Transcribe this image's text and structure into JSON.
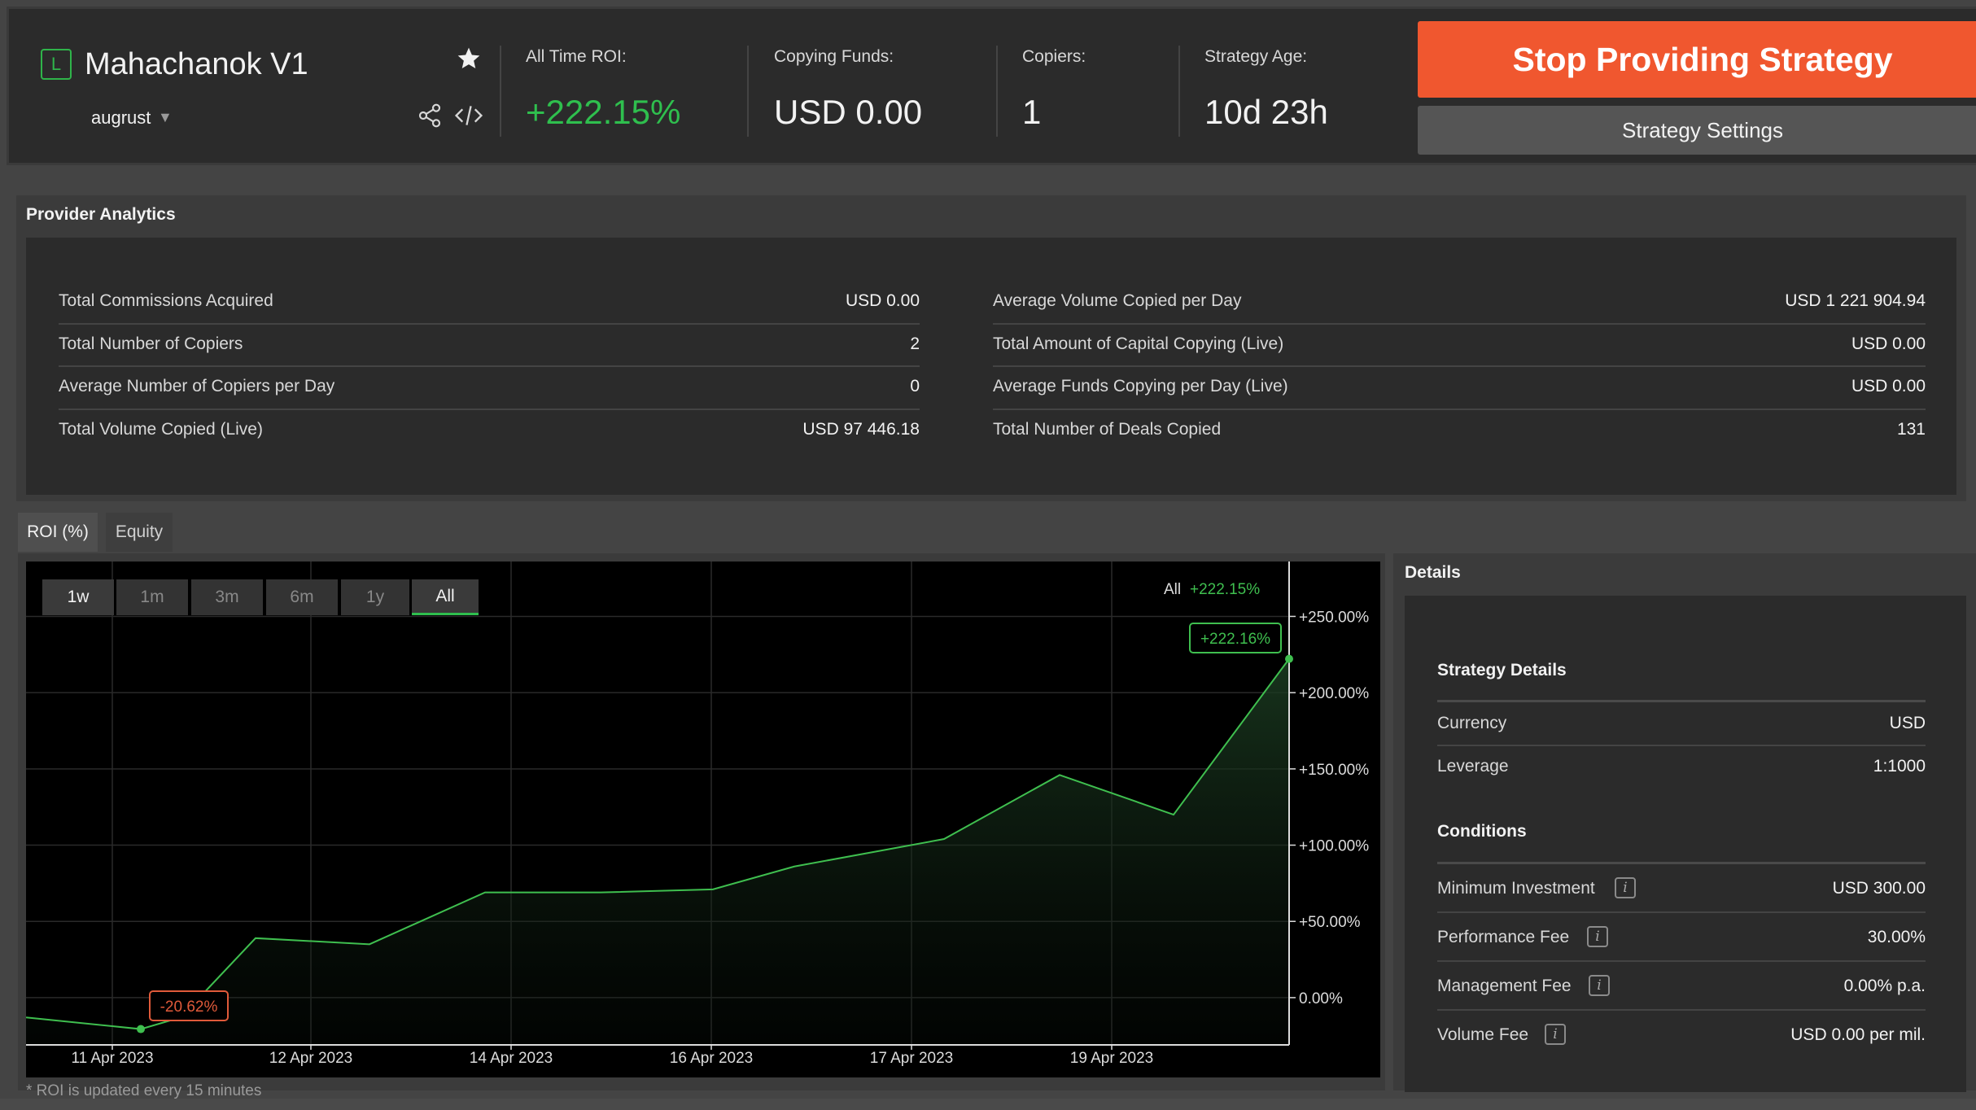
{
  "header": {
    "badge": "L",
    "strategy_name": "Mahachanok V1",
    "author": "augrust",
    "stats": [
      {
        "label": "All Time ROI:",
        "value": "+222.15%"
      },
      {
        "label": "Copying Funds:",
        "value": "USD 0.00"
      },
      {
        "label": "Copiers:",
        "value": "1"
      },
      {
        "label": "Strategy Age:",
        "value": "10d 23h"
      }
    ],
    "stop_button": "Stop Providing Strategy",
    "settings_button": "Strategy Settings"
  },
  "analytics": {
    "title": "Provider Analytics",
    "left": [
      {
        "label": "Total Commissions Acquired",
        "value": "USD 0.00"
      },
      {
        "label": "Total Number of Copiers",
        "value": "2"
      },
      {
        "label": "Average Number of Copiers per Day",
        "value": "0"
      },
      {
        "label": "Total Volume Copied (Live)",
        "value": "USD 97 446.18"
      }
    ],
    "right": [
      {
        "label": "Average Volume Copied per Day",
        "value": "USD 1 221 904.94"
      },
      {
        "label": "Total Amount of Capital Copying (Live)",
        "value": "USD 0.00"
      },
      {
        "label": "Average Funds Copying per Day (Live)",
        "value": "USD 0.00"
      },
      {
        "label": "Total Number of Deals Copied",
        "value": "131"
      }
    ]
  },
  "tabs": {
    "roi": "ROI (%)",
    "equity": "Equity"
  },
  "chart": {
    "ranges": [
      "1w",
      "1m",
      "3m",
      "6m",
      "1y",
      "All"
    ],
    "selected_range": "All",
    "legend_label": "All",
    "legend_value": "+222.15%",
    "last_label": "+222.16%",
    "min_label": "-20.62%",
    "footnote": "* ROI is updated every 15 minutes",
    "line_color": "#3fbf4f",
    "min_color": "#e05a3a"
  },
  "chart_data": {
    "type": "area",
    "x": [
      "10 Apr 2023",
      "11 Apr 2023",
      "11 Apr 2023",
      "12 Apr 2023",
      "13 Apr 2023",
      "14 Apr 2023",
      "15 Apr 2023",
      "16 Apr 2023",
      "16 Apr 2023",
      "17 Apr 2023",
      "18 Apr 2023",
      "19 Apr 2023",
      "20 Apr 2023"
    ],
    "values": [
      -13,
      -20.62,
      -13,
      39,
      35,
      69,
      69,
      71,
      86,
      104,
      146,
      120,
      222.16
    ],
    "x_ticks": [
      "11 Apr 2023",
      "12 Apr 2023",
      "14 Apr 2023",
      "16 Apr 2023",
      "17 Apr 2023",
      "19 Apr 2023"
    ],
    "y_ticks": [
      "+250.00%",
      "+200.00%",
      "+150.00%",
      "+100.00%",
      "+50.00%",
      "0.00%"
    ],
    "ylim": [
      -31,
      286
    ]
  },
  "details": {
    "title": "Details",
    "strategy_section": "Strategy Details",
    "strategy_rows": [
      {
        "label": "Currency",
        "value": "USD"
      },
      {
        "label": "Leverage",
        "value": "1:1000"
      }
    ],
    "conditions_section": "Conditions",
    "condition_rows": [
      {
        "label": "Minimum Investment",
        "value": "USD 300.00"
      },
      {
        "label": "Performance Fee",
        "value": "30.00%"
      },
      {
        "label": "Management Fee",
        "value": "0.00% p.a."
      },
      {
        "label": "Volume Fee",
        "value": "USD 0.00 per mil."
      }
    ],
    "info_glyph": "i"
  }
}
